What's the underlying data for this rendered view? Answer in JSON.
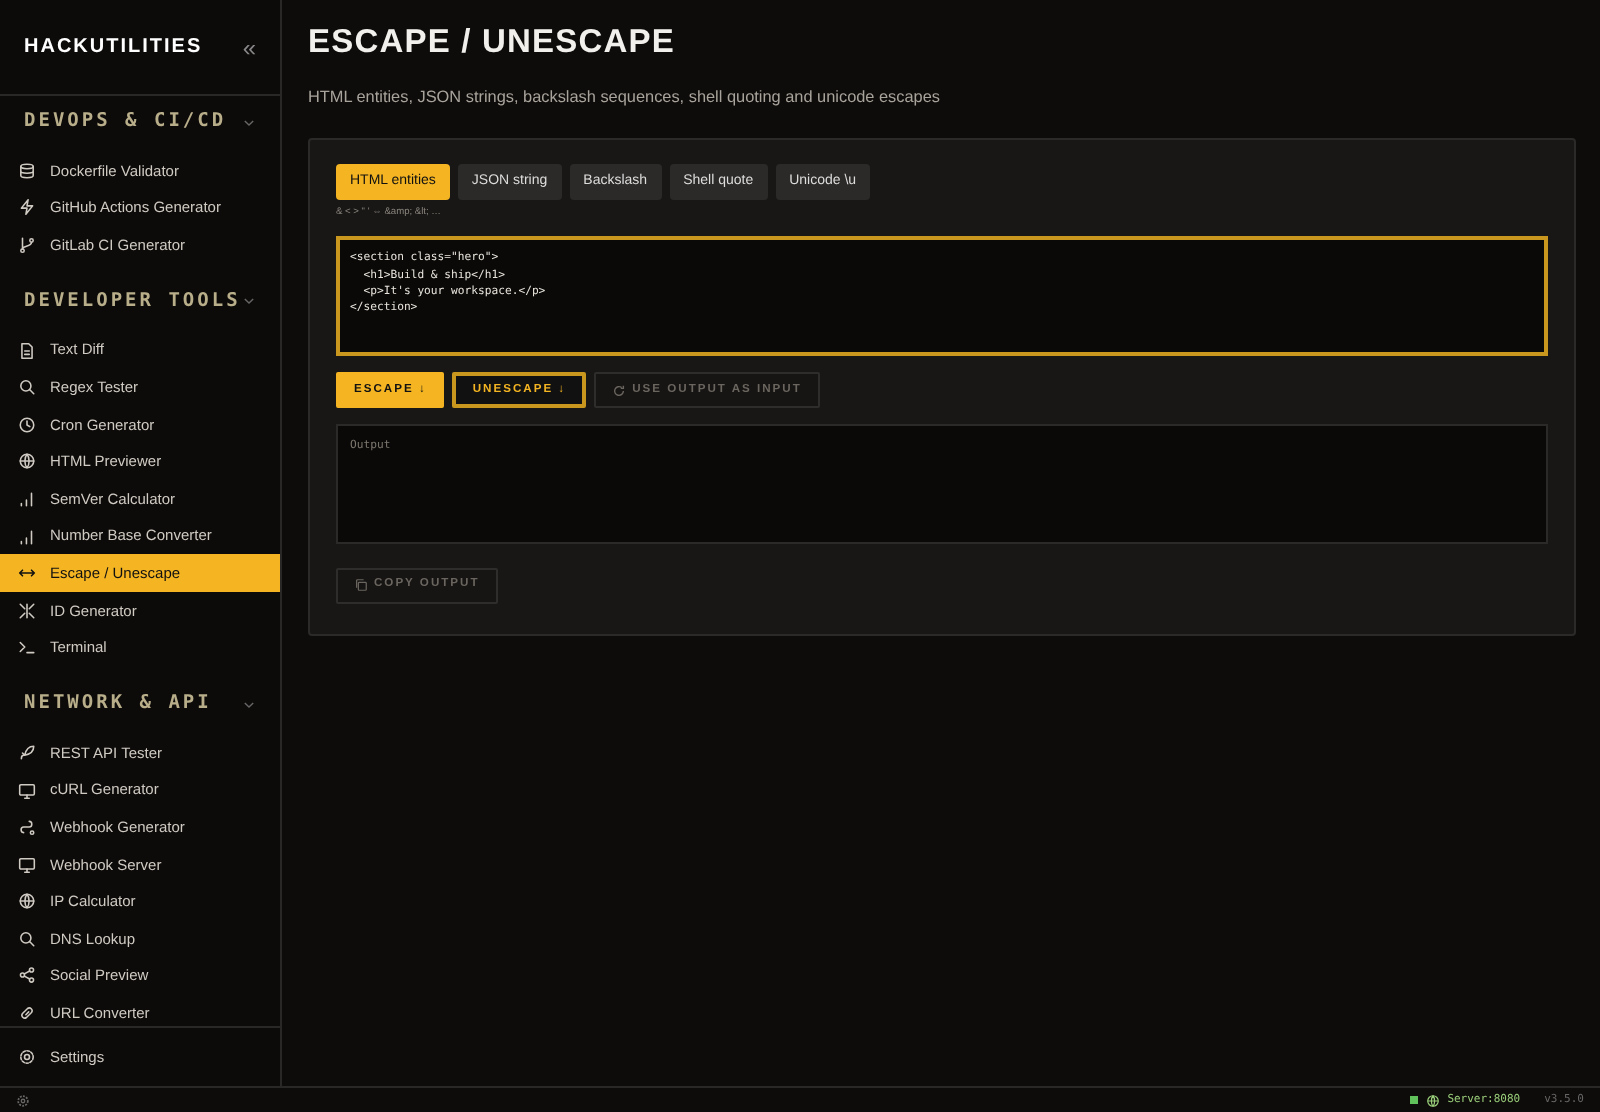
{
  "sidebar": {
    "brand": "HACKUTILITIES",
    "collapse_glyph": "«",
    "sections": [
      {
        "title": "DEVOPS & CI/CD",
        "expanded": true,
        "items": [
          {
            "label": "Dockerfile Validator",
            "selected": false
          },
          {
            "label": "GitHub Actions Generator",
            "selected": false
          },
          {
            "label": "GitLab CI Generator",
            "selected": false
          }
        ]
      },
      {
        "title": "DEVELOPER TOOLS",
        "expanded": true,
        "items": [
          {
            "label": "Text Diff",
            "selected": false
          },
          {
            "label": "Regex Tester",
            "selected": false
          },
          {
            "label": "Cron Generator",
            "selected": false
          },
          {
            "label": "HTML Previewer",
            "selected": false
          },
          {
            "label": "SemVer Calculator",
            "selected": false
          },
          {
            "label": "Number Base Converter",
            "selected": false
          },
          {
            "label": "Escape / Unescape",
            "selected": true
          },
          {
            "label": "ID Generator",
            "selected": false
          },
          {
            "label": "Terminal",
            "selected": false
          }
        ]
      },
      {
        "title": "NETWORK & API",
        "expanded": true,
        "items": [
          {
            "label": "REST API Tester",
            "selected": false
          },
          {
            "label": "cURL Generator",
            "selected": false
          },
          {
            "label": "Webhook Generator",
            "selected": false
          },
          {
            "label": "Webhook Server",
            "selected": false
          },
          {
            "label": "IP Calculator",
            "selected": false
          },
          {
            "label": "DNS Lookup",
            "selected": false
          },
          {
            "label": "Social Preview",
            "selected": false
          },
          {
            "label": "URL Converter",
            "selected": false
          }
        ]
      }
    ],
    "footer": "Settings"
  },
  "page": {
    "title": "ESCAPE / UNESCAPE",
    "subtitle": "HTML entities, JSON strings, backslash sequences, shell quoting and unicode escapes"
  },
  "modes": [
    {
      "label": "HTML entities",
      "selected": true
    },
    {
      "label": "JSON string",
      "selected": false
    },
    {
      "label": "Backslash",
      "selected": false
    },
    {
      "label": "Shell quote",
      "selected": false
    },
    {
      "label": "Unicode \\u",
      "selected": false
    }
  ],
  "mode_hint": "& < > \" ' ⇔ &amp; &lt; …",
  "input": {
    "value": "<section class=\"hero\">\n  <h1>Build & ship</h1>\n  <p>It's your workspace.</p>\n</section>"
  },
  "actions": [
    {
      "label": "ESCAPE ↓",
      "kind": "primary"
    },
    {
      "label": "UNESCAPE ↓",
      "kind": "outline"
    },
    {
      "label": "USE OUTPUT AS INPUT",
      "kind": "disabled"
    }
  ],
  "output": {
    "placeholder": "Output"
  },
  "copy_button": {
    "label": "COPY OUTPUT",
    "disabled": true
  },
  "status_bar": {
    "server": "Server:8080",
    "online": true,
    "version": "v3.5.0"
  }
}
